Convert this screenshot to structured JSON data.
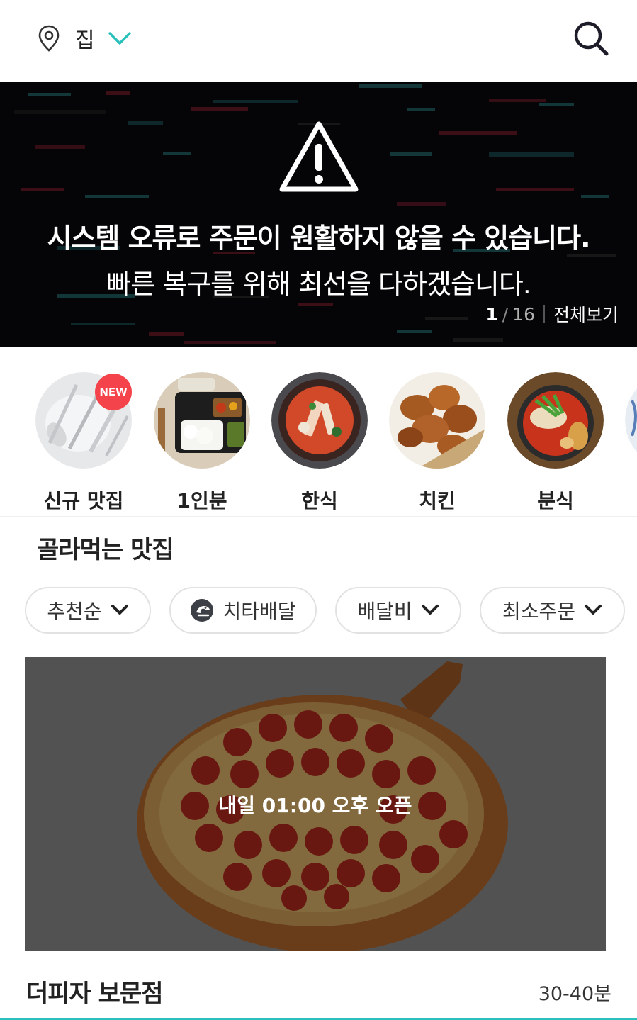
{
  "header": {
    "location_name": "집",
    "location_icon": "location-pin-icon",
    "dropdown_icon": "chevron-down-icon",
    "search_icon": "search-icon",
    "accent_color": "#2ac1bc"
  },
  "banner": {
    "icon": "warning-icon",
    "line1": "시스템 오류로 주문이 원활하지 않을 수 있습니다.",
    "line2": "빠른 복구를 위해 최선을 다하겠습니다.",
    "page_current": "1",
    "page_separator": "/",
    "page_total": "16",
    "view_all": "전체보기"
  },
  "categories": [
    {
      "label": "신규 맛집",
      "badge": "NEW"
    },
    {
      "label": "1인분"
    },
    {
      "label": "한식"
    },
    {
      "label": "치킨"
    },
    {
      "label": "분식"
    }
  ],
  "section": {
    "title": "골라먹는 맛집"
  },
  "filters": [
    {
      "label": "추천순",
      "icon": "chevron-down-icon"
    },
    {
      "label": "치타배달",
      "icon": "cheetah-icon"
    },
    {
      "label": "배달비",
      "icon": "chevron-down-icon"
    },
    {
      "label": "최소주문",
      "icon": "chevron-down-icon"
    }
  ],
  "restaurant": {
    "open_notice": "내일 01:00 오후 오픈",
    "name": "더피자 보문점",
    "delivery_time": "30-40분"
  }
}
